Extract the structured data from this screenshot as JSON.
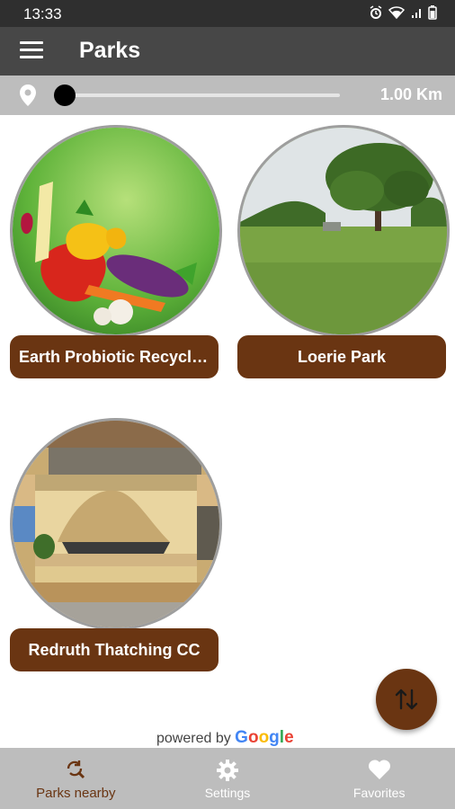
{
  "status_bar": {
    "time": "13:33"
  },
  "app_bar": {
    "title": "Parks"
  },
  "distance": {
    "value": "1.00 Km",
    "slider_fraction": 0.0
  },
  "parks": [
    {
      "name": "Earth Probiotic Recycli..."
    },
    {
      "name": "Loerie Park"
    },
    {
      "name": "Redruth Thatching CC"
    }
  ],
  "attribution": {
    "prefix": "powered by",
    "brand": "Google"
  },
  "bottom_nav": [
    {
      "label": "Parks nearby",
      "icon": "search-refresh-icon",
      "active": true
    },
    {
      "label": "Settings",
      "icon": "gear-icon",
      "active": false
    },
    {
      "label": "Favorites",
      "icon": "heart-icon",
      "active": false
    }
  ],
  "colors": {
    "accent_brown": "#6a3512",
    "app_bar": "#474747",
    "nav_bg": "#bdbdbd"
  }
}
